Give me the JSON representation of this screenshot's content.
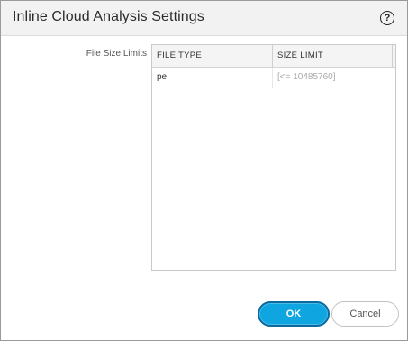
{
  "dialog": {
    "title": "Inline Cloud Analysis Settings",
    "help_glyph": "?"
  },
  "form": {
    "file_size_limits_label": "File Size Limits"
  },
  "grid": {
    "columns": [
      "FILE TYPE",
      "SIZE LIMIT"
    ],
    "rows": [
      {
        "file_type": "pe",
        "size_limit_placeholder": "[<= 10485760]"
      }
    ]
  },
  "buttons": {
    "ok": "OK",
    "cancel": "Cancel"
  },
  "colors": {
    "ok_bg": "#0ea5e0",
    "ok_border": "#0b6aa0",
    "header_bg": "#f2f2f2"
  }
}
